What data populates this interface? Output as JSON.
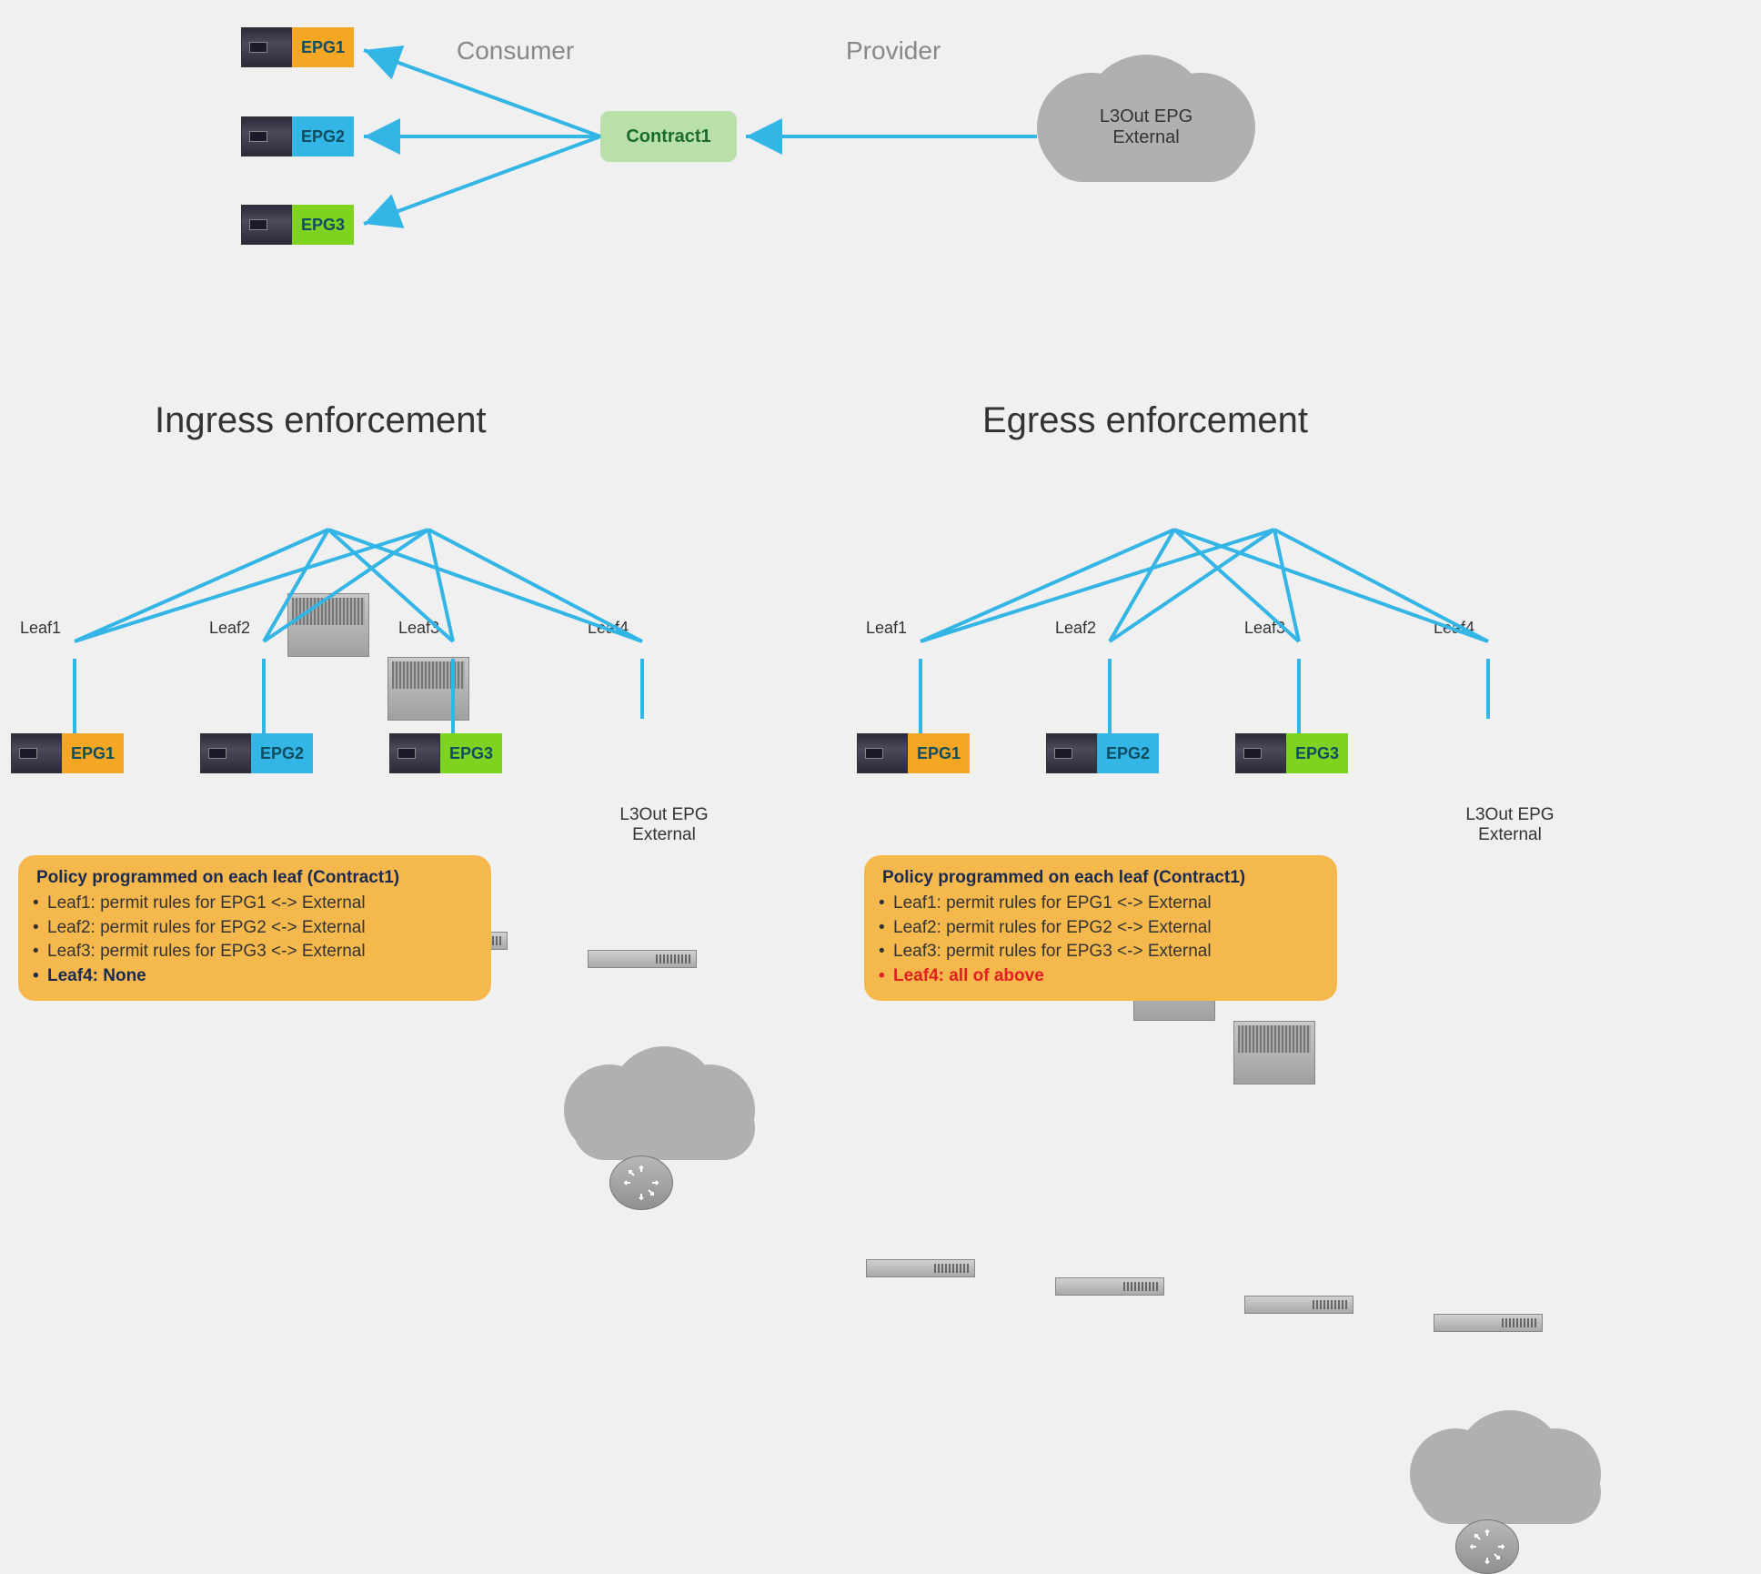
{
  "top": {
    "epg1": "EPG1",
    "epg2": "EPG2",
    "epg3": "EPG3",
    "consumer_label": "Consumer",
    "contract_label": "Contract1",
    "provider_label": "Provider",
    "cloud_line1": "L3Out EPG",
    "cloud_line2": "External"
  },
  "sections": {
    "ingress_title": "Ingress enforcement",
    "egress_title": "Egress enforcement"
  },
  "leaves": {
    "leaf1": "Leaf1",
    "leaf2": "Leaf2",
    "leaf3": "Leaf3",
    "leaf4": "Leaf4"
  },
  "bottom_epgs": {
    "epg1": "EPG1",
    "epg2": "EPG2",
    "epg3": "EPG3"
  },
  "bottom_cloud": {
    "line1": "L3Out EPG",
    "line2": "External"
  },
  "policy_ingress": {
    "title": "Policy programmed on each leaf (Contract1)",
    "leaf1": "Leaf1: permit rules for EPG1 <-> External",
    "leaf2": "Leaf2: permit rules for EPG2 <-> External",
    "leaf3": "Leaf3: permit rules for EPG3 <-> External",
    "leaf4": "Leaf4: None"
  },
  "policy_egress": {
    "title": "Policy programmed on each leaf (Contract1)",
    "leaf1": "Leaf1: permit rules for EPG1 <-> External",
    "leaf2": "Leaf2: permit rules for EPG2 <-> External",
    "leaf3": "Leaf3: permit rules for EPG3 <-> External",
    "leaf4": "Leaf4: all of above"
  }
}
